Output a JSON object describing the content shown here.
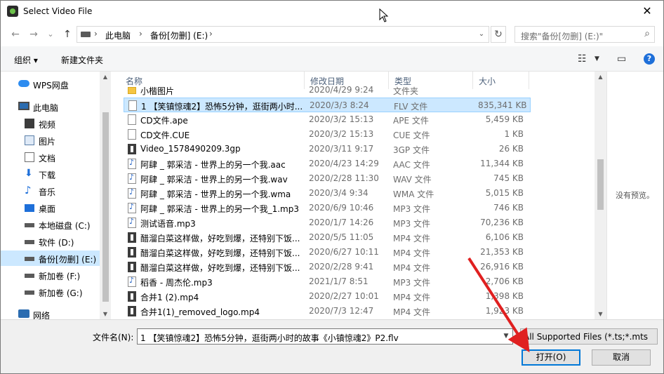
{
  "window": {
    "title": "Select Video File",
    "close_glyph": "✕"
  },
  "nav": {
    "back": "←",
    "forward": "→",
    "recent": "⌄",
    "up": "↑",
    "breadcrumbs": [
      "此电脑",
      "备份[勿删] (E:)"
    ],
    "refresh": "↻",
    "search_placeholder": "搜索\"备份[勿删] (E:)\""
  },
  "toolbar": {
    "organize": "组织 ▾",
    "new_folder": "新建文件夹"
  },
  "sidebar": {
    "items": [
      {
        "label": "WPS网盘",
        "icon": "cloud-icon"
      },
      {
        "label": "此电脑",
        "icon": "computer-icon"
      },
      {
        "label": "视频",
        "icon": "video-folder-icon"
      },
      {
        "label": "图片",
        "icon": "pictures-folder-icon"
      },
      {
        "label": "文档",
        "icon": "documents-folder-icon"
      },
      {
        "label": "下载",
        "icon": "download-icon"
      },
      {
        "label": "音乐",
        "icon": "music-icon"
      },
      {
        "label": "桌面",
        "icon": "desktop-icon"
      },
      {
        "label": "本地磁盘 (C:)",
        "icon": "drive-icon"
      },
      {
        "label": "软件 (D:)",
        "icon": "drive-icon"
      },
      {
        "label": "备份[勿删] (E:)",
        "icon": "drive-icon",
        "selected": true
      },
      {
        "label": "新加卷 (F:)",
        "icon": "drive-icon"
      },
      {
        "label": "新加卷 (G:)",
        "icon": "drive-icon"
      },
      {
        "label": "网络",
        "icon": "network-icon"
      }
    ]
  },
  "list": {
    "columns": [
      "名称",
      "修改日期",
      "类型",
      "大小"
    ],
    "rows": [
      {
        "name": "小楷图片",
        "date": "2020/4/29 9:24",
        "type": "文件夹",
        "size": "",
        "kind": "folder"
      },
      {
        "name": "1 【笑镇惊魂2】恐怖5分钟，逛街两小时...",
        "date": "2020/3/3 8:24",
        "type": "FLV 文件",
        "size": "835,341 KB",
        "kind": "file",
        "selected": true
      },
      {
        "name": "CD文件.ape",
        "date": "2020/3/2 15:13",
        "type": "APE 文件",
        "size": "5,459 KB",
        "kind": "file"
      },
      {
        "name": "CD文件.CUE",
        "date": "2020/3/2 15:13",
        "type": "CUE 文件",
        "size": "1 KB",
        "kind": "file"
      },
      {
        "name": "Video_1578490209.3gp",
        "date": "2020/3/11 9:17",
        "type": "3GP 文件",
        "size": "26 KB",
        "kind": "video"
      },
      {
        "name": "阿肆 _ 郭采洁 - 世界上的另一个我.aac",
        "date": "2020/4/23 14:29",
        "type": "AAC 文件",
        "size": "11,344 KB",
        "kind": "music"
      },
      {
        "name": "阿肆 _ 郭采洁 - 世界上的另一个我.wav",
        "date": "2020/2/28 11:30",
        "type": "WAV 文件",
        "size": "745 KB",
        "kind": "music"
      },
      {
        "name": "阿肆 _ 郭采洁 - 世界上的另一个我.wma",
        "date": "2020/3/4 9:34",
        "type": "WMA 文件",
        "size": "5,015 KB",
        "kind": "music"
      },
      {
        "name": "阿肆 _ 郭采洁 - 世界上的另一个我_1.mp3",
        "date": "2020/6/9 10:46",
        "type": "MP3 文件",
        "size": "746 KB",
        "kind": "music"
      },
      {
        "name": "测试语音.mp3",
        "date": "2020/1/7 14:26",
        "type": "MP3 文件",
        "size": "70,236 KB",
        "kind": "music"
      },
      {
        "name": "醋溜白菜这样做，好吃到爆，还特别下饭...",
        "date": "2020/5/5 11:05",
        "type": "MP4 文件",
        "size": "6,106 KB",
        "kind": "video"
      },
      {
        "name": "醋溜白菜这样做，好吃到爆，还特别下饭...",
        "date": "2020/6/27 10:11",
        "type": "MP4 文件",
        "size": "21,353 KB",
        "kind": "video"
      },
      {
        "name": "醋溜白菜这样做，好吃到爆，还特别下饭...",
        "date": "2020/2/28 9:41",
        "type": "MP4 文件",
        "size": "26,916 KB",
        "kind": "video"
      },
      {
        "name": "稻香 - 周杰伦.mp3",
        "date": "2021/1/7 8:51",
        "type": "MP3 文件",
        "size": "2,706 KB",
        "kind": "music"
      },
      {
        "name": "合并1 (2).mp4",
        "date": "2020/2/27 10:01",
        "type": "MP4 文件",
        "size": "1,398 KB",
        "kind": "video"
      },
      {
        "name": "合并1(1)_removed_logo.mp4",
        "date": "2020/7/3 12:47",
        "type": "MP4 文件",
        "size": "1,923 KB",
        "kind": "video"
      }
    ]
  },
  "preview": {
    "message": "没有预览。"
  },
  "footer": {
    "filename_label": "文件名(N):",
    "filename_value": "1 【笑镇惊魂2】恐怖5分钟，逛街两小时的故事《小镇惊魂2》P2.flv",
    "filter_value": "All Supported Files (*.ts;*.mts",
    "open_label": "打开(O)",
    "cancel_label": "取消"
  },
  "colors": {
    "selection": "#cce8ff",
    "accent": "#0078d7",
    "arrow": "#e02020"
  }
}
